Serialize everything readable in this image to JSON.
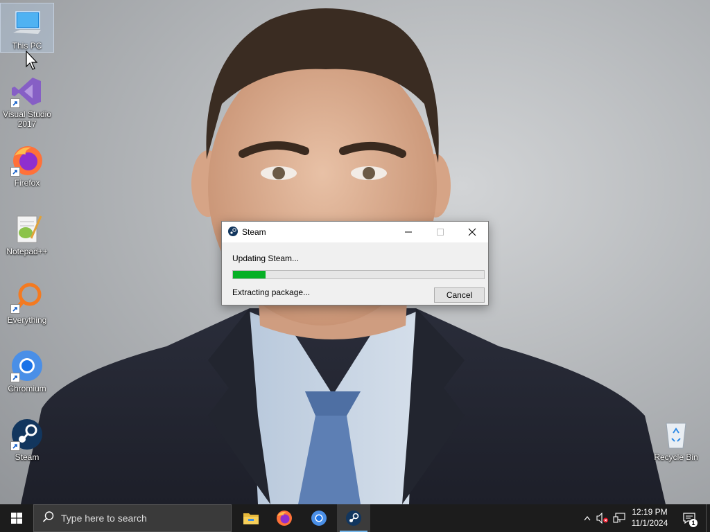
{
  "desktop": {
    "icons": [
      {
        "label": "This PC"
      },
      {
        "label": "Visual Studio 2017"
      },
      {
        "label": "Firefox"
      },
      {
        "label": "Notepad++"
      },
      {
        "label": "Everything"
      },
      {
        "label": "Chromium"
      },
      {
        "label": "Steam"
      },
      {
        "label": "Recycle Bin"
      }
    ]
  },
  "dialog": {
    "title": "Steam",
    "status_line1": "Updating Steam...",
    "status_line2": "Extracting package...",
    "progress_fraction": 0.13,
    "cancel_label": "Cancel",
    "progress_color": "#06b025"
  },
  "taskbar": {
    "search_placeholder": "Type here to search",
    "pinned_apps": [
      "file-explorer-icon",
      "firefox-icon",
      "chromium-icon",
      "steam-icon"
    ],
    "time": "12:19 PM",
    "date": "11/1/2024",
    "notification_count": "1"
  }
}
